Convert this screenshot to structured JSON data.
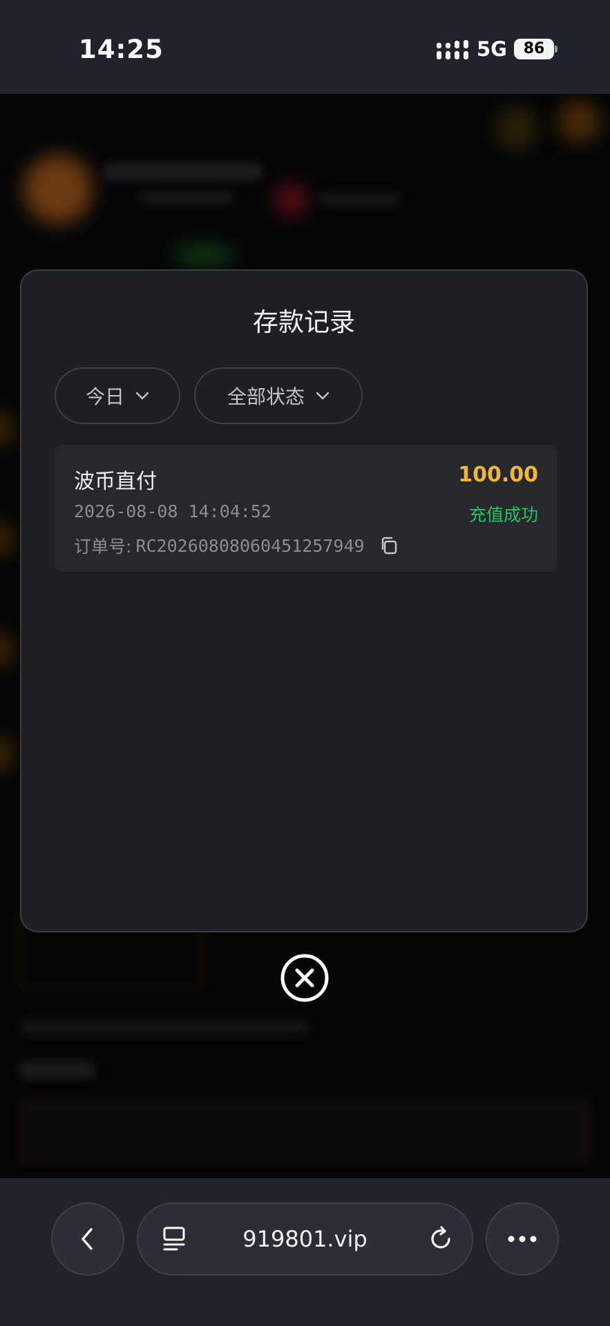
{
  "status_bar": {
    "time": "14:25",
    "network": "5G",
    "battery": "86"
  },
  "modal": {
    "title": "存款记录",
    "filters": [
      {
        "label": "今日"
      },
      {
        "label": "全部状态"
      }
    ],
    "records": [
      {
        "method": "波币直付",
        "amount": "100.00",
        "datetime": "2026-08-08 14:04:52",
        "status": "充值成功",
        "order_label": "订单号:",
        "order_no": "RC2026080806045125​7949"
      }
    ]
  },
  "browser": {
    "url": "919801.vip"
  },
  "colors": {
    "amount": "#f2b632",
    "success": "#22c55e",
    "modal_bg": "#1e1f24",
    "card_bg": "#27282e"
  }
}
